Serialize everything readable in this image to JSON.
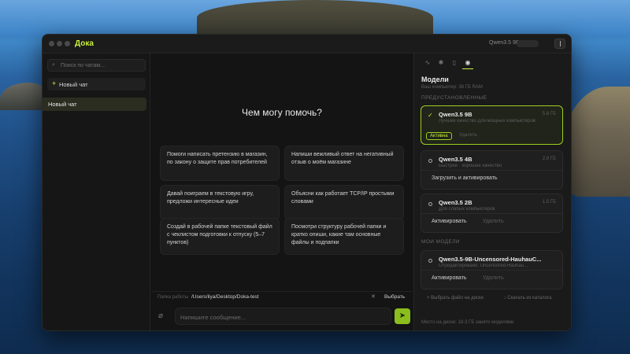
{
  "app": {
    "title": "Дока",
    "current_model": "Qwen3.5 9B"
  },
  "sidebar": {
    "search_placeholder": "Поиск по чатам...",
    "new_chat": "Новый чат",
    "chats": [
      {
        "label": "Новый чат",
        "selected": true
      }
    ]
  },
  "main": {
    "heading": "Чем могу помочь?",
    "suggestions": [
      "Помоги написать претензию в магазин, по закону о защите прав потребителей",
      "Напиши вежливый ответ на негативный отзыв о моём магазине",
      "Давай поиграем в текстовую игру, предложи интересные идеи",
      "Объясни как работает TCP/IP простыми словами",
      "Создай в рабочей папке текстовый файл с чеклистом подготовки к отпуску (5–7 пунктов)",
      "Посмотри структуру рабочей папки и кратко опиши, какие там основные файлы и подпапки"
    ],
    "folder": {
      "label": "Папка работы",
      "path": "/Users/ilya/Desktop/Doka-test",
      "clear": "✕",
      "choose": "Выбрать"
    },
    "composer_placeholder": "Напишите сообщение..."
  },
  "panel": {
    "tabs": [
      "activity-icon",
      "chat-icon",
      "bookmark-icon",
      "settings-icon"
    ],
    "active_tab": 3,
    "title": "Модели",
    "subtitle": "Ваш компьютер: 36 ГБ RAM",
    "section_preinstalled": "ПРЕДУСТАНОВЛЕННЫЕ",
    "section_mine": "МОИ МОДЕЛИ",
    "models": [
      {
        "name": "Qwen3.5 9B",
        "desc": "Лучшее качество для мощных компьютеров",
        "size": "5.8 ГБ",
        "active": true,
        "badge": "Активна",
        "secondary": "Удалить"
      },
      {
        "name": "Qwen3.5 4B",
        "desc": "Быстрее · хорошее качество",
        "size": "2.9 ГБ",
        "action": "Загрузить и активировать"
      },
      {
        "name": "Qwen3.5 2B",
        "desc": "Для слабых компьютеров",
        "size": "1.5 ГБ",
        "action": "Активировать",
        "secondary": "Удалить"
      },
      {
        "name": "Qwen3.5-9B-Uncensored-HauhauC...",
        "desc": "Отредактировано: Uncensored-Hauhau...",
        "size": "",
        "action": "Активировать",
        "secondary": "Удалить"
      }
    ],
    "btn_pick_file": "+ Выбрать файл на диске",
    "btn_download_catalog": "↓ Скачать из каталога",
    "disk_info": "Место на диске: 18.3 ГБ занято моделями"
  }
}
